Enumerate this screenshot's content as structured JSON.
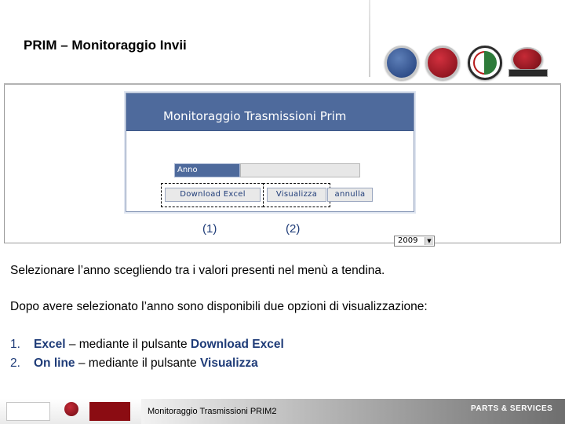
{
  "header": {
    "title": "PRIM – Monitoraggio Invii",
    "brands": [
      "lancia-logo",
      "fiat-logo",
      "alfa-romeo-logo",
      "fiat-professional-logo"
    ]
  },
  "app": {
    "title": "Monitoraggio Trasmissioni Prim",
    "anno_label": "Anno",
    "year_selected": "2009",
    "buttons": {
      "download": "Download Excel",
      "visualizza": "Visualizza",
      "annulla": "annulla"
    },
    "colors": {
      "header": "#4e6a9c",
      "accent": "#1f3c78"
    }
  },
  "markers": [
    "(1)",
    "(2)"
  ],
  "body": {
    "para1": "Selezionare l’anno scegliendo tra i valori presenti nel menù a tendina.",
    "para2": "Dopo avere selezionato l’anno sono disponibili due opzioni di visualizzazione:",
    "items": [
      {
        "num": "1.",
        "label": "Excel",
        "text": " – mediante il pulsante ",
        "button": "Download Excel"
      },
      {
        "num": "2.",
        "label": "On line",
        "text": " – mediante il pulsante ",
        "button": "Visualizza"
      }
    ]
  },
  "footer": {
    "text": "Monitoraggio Trasmissioni PRIM2",
    "brand": "PARTS & SERVICES",
    "logos": [
      "abarth-service-logo",
      "fiat-service-logo",
      "alfa-service-logo"
    ]
  }
}
